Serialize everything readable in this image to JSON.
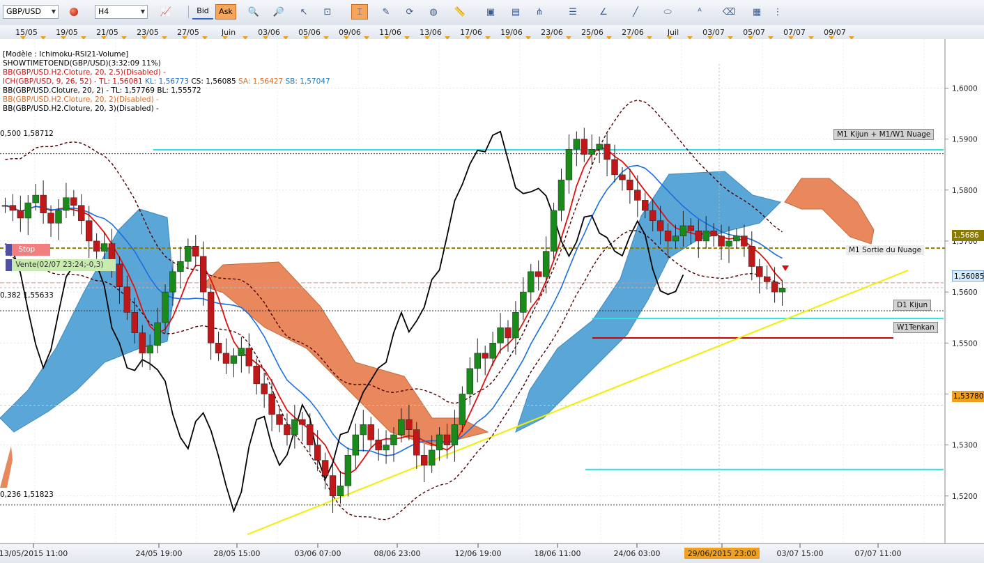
{
  "toolbar": {
    "symbol": "GBP/USD",
    "timeframe": "H4",
    "bid_label": "Bid",
    "ask_label": "Ask",
    "icons": [
      "chart-type-icon",
      "indicator-icon",
      "zoom-in-icon",
      "zoom-out-icon",
      "cursor-icon",
      "zoom-area-icon",
      "cursor-mode-icon",
      "properties-icon",
      "refresh-icon",
      "globe-icon",
      "ruler-icon",
      "snapshot-icon",
      "template-icon",
      "pitchfork-icon",
      "hline-icon",
      "trend-line-icon",
      "line-color-icon",
      "ellipse-icon",
      "text-icon",
      "eraser-icon",
      "layout-icon",
      "more-icon"
    ]
  },
  "legend": {
    "line1": "[Modèle : Ichimoku-RSI21-Volume]",
    "line2": "SHOWTIMETOEND(GBP/USD)(3:32:09 11%)",
    "line3": "BB(GBP/USD.H2.Cloture, 20, 2.5)(Disabled) -",
    "line4_prefix": "ICH(GBP/USD, 9, 26, 52) -",
    "line4_tl": "TL: 1,56081",
    "line4_kl": "KL: 1,56773",
    "line4_cs": "CS: 1,56085",
    "line4_sa": "SA: 1,56427",
    "line4_sb": "SB: 1,57047",
    "line5": "BB(GBP/USD.Cloture, 20, 2) -  TL: 1,57769  BL: 1,55572",
    "line6": "BB(GBP/USD.H2.Cloture, 20, 2)(Disabled) -",
    "line7": "BB(GBP/USD.H2.Cloture, 20, 3)(Disabled) -"
  },
  "top_axis": [
    "15/05",
    "19/05",
    "21/05",
    "23/05",
    "27/05",
    "Juin",
    "03/06",
    "05/06",
    "09/06",
    "11/06",
    "13/06",
    "17/06",
    "19/06",
    "23/06",
    "25/06",
    "27/06",
    "Juil",
    "03/07",
    "05/07",
    "07/07",
    "09/07"
  ],
  "bottom_axis": [
    "13/05/2015 11:00",
    "24/05 19:00",
    "28/05 15:00",
    "03/06 07:00",
    "08/06 23:00",
    "12/06 19:00",
    "18/06 11:00",
    "24/06 03:00",
    "29/06/2015 23:00",
    "03/07 15:00",
    "07/07 11:00"
  ],
  "price_axis": [
    "1,6000",
    "1,5900",
    "1,5800",
    "1,5700",
    "1,5600",
    "1,5500",
    "1,5400",
    "1,5300",
    "1,5200"
  ],
  "price_tags": {
    "olive": "1,5686",
    "current": "1,56085",
    "orange": "1,53780"
  },
  "fib_labels": {
    "f500": "0,500 1,58712",
    "f382": "0,382 1,55633",
    "f236": "0,236 1,51823"
  },
  "orders": {
    "stop": "Stop",
    "sell": "Vente(02/07 23:24;-0,3)"
  },
  "annotations": {
    "kijun_cloud": "M1 Kijun + M1/W1 Nuage",
    "cloud_exit": "M1 Sortie du Nuage",
    "d1_kijun": "D1 Kijun",
    "w1_tenkan": "W1Tenkan"
  },
  "colors": {
    "kumo_bull": "#5aa6d6",
    "kumo_bear": "#e8885c",
    "tenkan": "#e01010",
    "kijun": "#1a6fe0",
    "chikou": "#000000",
    "bollinger": "#4a0000",
    "trendline": "#f0f000",
    "cyan_levels": "#30e0e0",
    "candle_up": "#1a8a1a",
    "candle_down": "#c01818",
    "olive_level": "#8a7a00",
    "w1_tenkan_line": "#cc0000"
  },
  "chart_data": {
    "type": "candlestick",
    "symbol": "GBP/USD",
    "timeframe": "H4",
    "ylim": [
      1.513,
      1.6032
    ],
    "horizontal_levels": [
      {
        "name": "M1 Kijun + M1/W1 Nuage",
        "value": 1.5879
      },
      {
        "name": "0,500",
        "value": 1.58712
      },
      {
        "name": "1,5686 level",
        "value": 1.5686
      },
      {
        "name": "0,382",
        "value": 1.55633
      },
      {
        "name": "D1 Kijun",
        "value": 1.5548
      },
      {
        "name": "W1Tenkan",
        "value": 1.551
      },
      {
        "name": "cyan low level",
        "value": 1.5252
      },
      {
        "name": "0,236",
        "value": 1.51823
      }
    ],
    "trendline": {
      "from": {
        "x": "28/05",
        "y": 1.5127
      },
      "to": {
        "x": "07/07",
        "y": 1.5626
      }
    },
    "candles_close": [
      1.577,
      1.576,
      1.5745,
      1.5775,
      1.579,
      1.5755,
      1.5735,
      1.576,
      1.5785,
      1.577,
      1.574,
      1.57,
      1.568,
      1.5695,
      1.5655,
      1.561,
      1.556,
      1.552,
      1.548,
      1.5495,
      1.554,
      1.56,
      1.564,
      1.566,
      1.569,
      1.567,
      1.56,
      1.55,
      1.548,
      1.546,
      1.5475,
      1.549,
      1.5455,
      1.542,
      1.54,
      1.536,
      1.534,
      1.532,
      1.535,
      1.534,
      1.53,
      1.527,
      1.524,
      1.52,
      1.522,
      1.528,
      1.532,
      1.534,
      1.531,
      1.529,
      1.53,
      1.532,
      1.535,
      1.533,
      1.528,
      1.526,
      1.529,
      1.532,
      1.53,
      1.534,
      1.54,
      1.545,
      1.548,
      1.547,
      1.55,
      1.553,
      1.551,
      1.556,
      1.56,
      1.564,
      1.563,
      1.568,
      1.576,
      1.582,
      1.588,
      1.59,
      1.587,
      1.588,
      1.589,
      1.586,
      1.583,
      1.582,
      1.58,
      1.578,
      1.576,
      1.574,
      1.572,
      1.57,
      1.571,
      1.573,
      1.572,
      1.57,
      1.572,
      1.571,
      1.569,
      1.57,
      1.571,
      1.569,
      1.565,
      1.563,
      1.562,
      1.56,
      1.5608
    ],
    "cloud_bull": {
      "x_start": 0.0,
      "x_end": 0.19
    },
    "series": [
      {
        "name": "ICH TL",
        "last": 1.56081
      },
      {
        "name": "ICH KL",
        "last": 1.56773
      },
      {
        "name": "ICH CS",
        "last": 1.56085
      },
      {
        "name": "ICH SA",
        "last": 1.56427
      },
      {
        "name": "ICH SB",
        "last": 1.57047
      },
      {
        "name": "BB TL",
        "last": 1.57769
      },
      {
        "name": "BB BL",
        "last": 1.55572
      }
    ]
  }
}
